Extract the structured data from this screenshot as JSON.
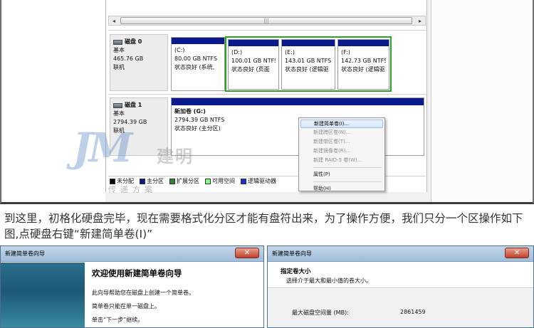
{
  "scrollbar": {
    "left_arrow": "◂",
    "right_arrow": "▸",
    "grip": "|||"
  },
  "disk0": {
    "title": "磁盘 0",
    "type": "基本",
    "size": "465.76 GB",
    "status": "联机",
    "partitions": [
      {
        "letter": "(C:)",
        "size": "80.00 GB NTFS",
        "state": "状态良好 (系统,"
      },
      {
        "letter": "(D:)",
        "size": "100.01 GB NTFS",
        "state": "状态良好 (页面"
      },
      {
        "letter": "(E:)",
        "size": "143.01 GB NTFS",
        "state": "状态良好 (逻辑驱"
      },
      {
        "letter": "(F:)",
        "size": "142.73 GB NTFS",
        "state": "状态良好 (逻辑驱"
      }
    ]
  },
  "disk1": {
    "title": "磁盘 1",
    "type": "基本",
    "size": "2794.39 GB",
    "status": "联机",
    "volume_name": "新加卷  (G:)",
    "volume_size": "2794.39 GB NTFS",
    "volume_state": "状态良好 (主分区)"
  },
  "legend": [
    {
      "label": "未分配",
      "color": "#000000"
    },
    {
      "label": "主分区",
      "color": "#0a1a8c"
    },
    {
      "label": "扩展分区",
      "color": "#2a8a2a"
    },
    {
      "label": "可用空间",
      "color": "#7dff7d"
    },
    {
      "label": "逻辑驱动器",
      "color": "#1a2adc"
    }
  ],
  "context_menu": {
    "items": [
      {
        "label": "新建简单卷(I)...",
        "enabled": true
      },
      {
        "label": "新建跨区卷(N)...",
        "enabled": false
      },
      {
        "label": "新建带区卷(T)...",
        "enabled": false
      },
      {
        "label": "新建镜像卷(R)...",
        "enabled": false
      },
      {
        "label": "新建 RAID-5 卷(W)...",
        "enabled": false
      }
    ],
    "properties": "属性(P)",
    "help": "帮助(H)"
  },
  "watermark": {
    "logo": "JM",
    "brand": "建明",
    "slogan": "传递方案"
  },
  "caption": "到这里，初格化硬盘完毕，现在需要格式化分区才能有盘符出来，为了操作方便，我们只分一个区操作如下图,点硬盘右键“新建简单卷(I)”",
  "wizard_left": {
    "title": "新建简单卷向导",
    "heading": "欢迎使用新建简单卷向导",
    "line1": "此向导帮助您在磁盘上创建一个简单卷。",
    "line2": "简单卷只能在单一磁盘上。",
    "line3": "单击“下一步”继续。"
  },
  "wizard_right": {
    "title": "新建简单卷向导",
    "heading": "指定卷大小",
    "sub": "选择介于最大和最小值的卷大小。",
    "max_label": "最大磁盘空间量 (MB):",
    "max_value": "2861459"
  },
  "close_glyph": "✕"
}
